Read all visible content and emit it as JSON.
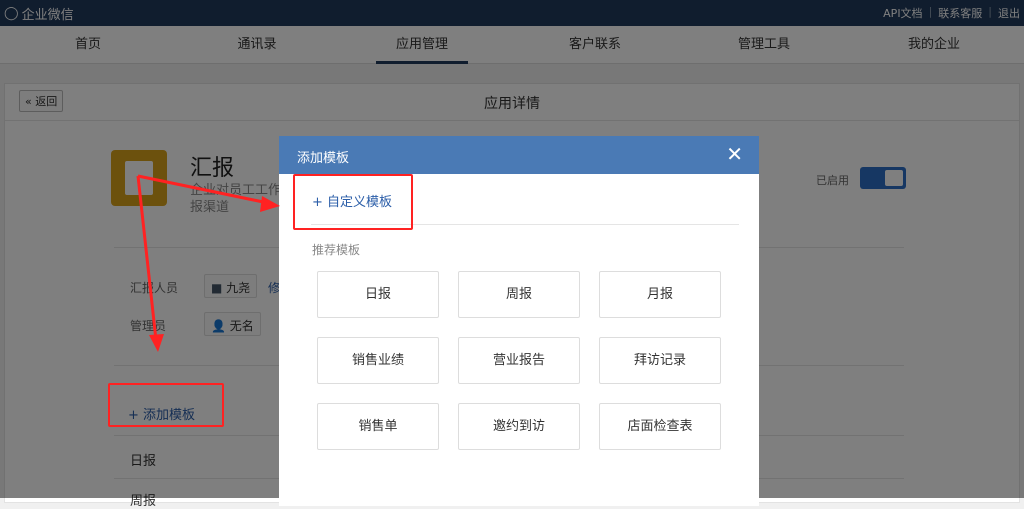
{
  "topbar": {
    "brand": "企业微信",
    "links": [
      "API文档",
      "联系客服",
      "退出"
    ]
  },
  "nav": {
    "tabs": [
      "首页",
      "通讯录",
      "应用管理",
      "客户联系",
      "管理工具",
      "我的企业"
    ],
    "active": "应用管理"
  },
  "panel": {
    "back": "« 返回",
    "title": "应用详情"
  },
  "app": {
    "name": "汇报",
    "desc_line1": "企业对员工工作",
    "desc_line2": "报渠道",
    "status_label": "已启用",
    "enabled": true
  },
  "fields": {
    "reporters_label": "汇报人员",
    "reporters_value": "九尧",
    "edit": "修",
    "admin_label": "管理员",
    "admin_value": "无名"
  },
  "templates_section": {
    "add_label": "添加模板",
    "rows": [
      "日报",
      "周报"
    ]
  },
  "modal": {
    "title": "添加模板",
    "close": "✕",
    "custom_label": "自定义模板",
    "recommended_label": "推荐模板",
    "templates": [
      "日报",
      "周报",
      "月报",
      "销售业绩",
      "营业报告",
      "拜访记录",
      "销售单",
      "邀约到访",
      "店面检查表"
    ]
  },
  "colors": {
    "topbar": "#213a5c",
    "modal_header": "#4a7ab5",
    "link": "#2a5da8",
    "annotation": "#ff2222"
  }
}
